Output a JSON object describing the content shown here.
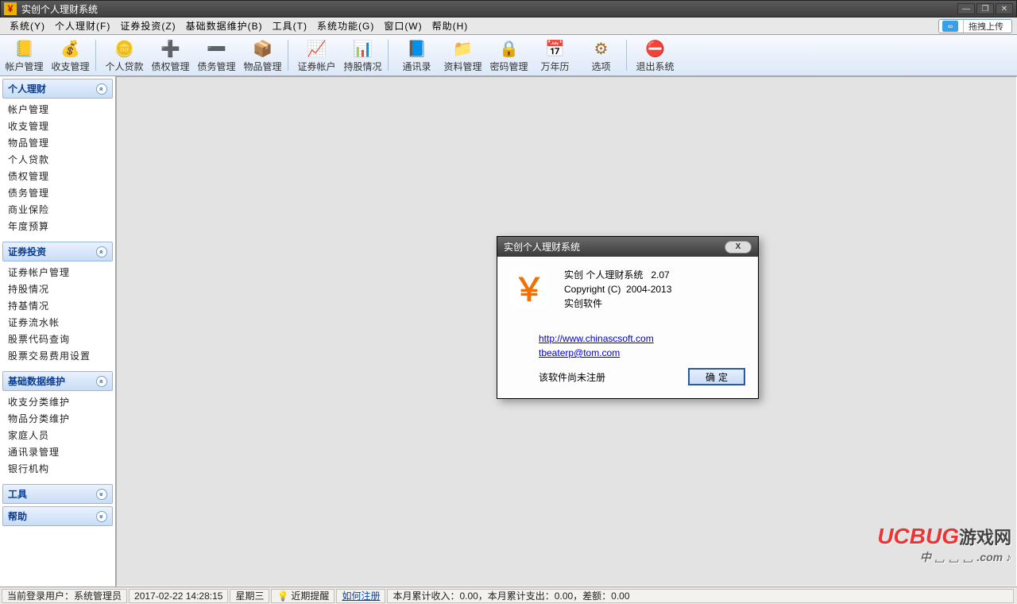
{
  "title": "实创个人理财系统",
  "menu": [
    "系统(Y)",
    "个人理财(F)",
    "证券投资(Z)",
    "基础数据维护(B)",
    "工具(T)",
    "系统功能(G)",
    "窗口(W)",
    "帮助(H)"
  ],
  "upload_label": "拖拽上传",
  "toolbar": [
    {
      "label": "帐户管理",
      "icon": "📒",
      "color": "#d39a00"
    },
    {
      "label": "收支管理",
      "icon": "💰",
      "color": "#d39a00"
    },
    {
      "label": "个人贷款",
      "icon": "🪙",
      "color": "#c08000"
    },
    {
      "label": "债权管理",
      "icon": "➕",
      "color": "#2a9a2a"
    },
    {
      "label": "债务管理",
      "icon": "➖",
      "color": "#c03020"
    },
    {
      "label": "物品管理",
      "icon": "📦",
      "color": "#a06a20"
    },
    {
      "label": "证券帐户",
      "icon": "📈",
      "color": "#2a7a2a"
    },
    {
      "label": "持股情况",
      "icon": "📊",
      "color": "#c05a20"
    },
    {
      "label": "通讯录",
      "icon": "📘",
      "color": "#2a5ac0"
    },
    {
      "label": "资料管理",
      "icon": "📁",
      "color": "#c07a20"
    },
    {
      "label": "密码管理",
      "icon": "🔒",
      "color": "#2a6ac0"
    },
    {
      "label": "万年历",
      "icon": "📅",
      "color": "#c03020"
    },
    {
      "label": "选项",
      "icon": "⚙",
      "color": "#a06a20"
    },
    {
      "label": "退出系统",
      "icon": "⛔",
      "color": "#c02020"
    }
  ],
  "toolbar_separators_after": [
    1,
    5,
    7,
    12
  ],
  "sidebar": [
    {
      "title": "个人理财",
      "items": [
        "帐户管理",
        "收支管理",
        "物品管理",
        "个人贷款",
        "债权管理",
        "债务管理",
        "商业保险",
        "年度预算"
      ]
    },
    {
      "title": "证券投资",
      "items": [
        "证券帐户管理",
        "持股情况",
        "持基情况",
        "证券流水帐",
        "股票代码查询",
        "股票交易费用设置"
      ]
    },
    {
      "title": "基础数据维护",
      "items": [
        "收支分类维护",
        "物品分类维护",
        "家庭人员",
        "通讯录管理",
        "银行机构"
      ]
    },
    {
      "title": "工具",
      "items": []
    },
    {
      "title": "帮助",
      "items": []
    }
  ],
  "about": {
    "title": "实创个人理财系统",
    "line1": "实创 个人理财系统   2.07",
    "line2": "Copyright (C)  2004-2013",
    "line3": "实创软件",
    "url": "http://www.chinascsoft.com",
    "email": "tbeaterp@tom.com",
    "reg_status": "该软件尚未注册",
    "ok": "确定"
  },
  "status": {
    "user_label": "当前登录用户：系统管理员",
    "datetime": "2017-02-22 14:28:15",
    "weekday": "星期三",
    "reminder": "近期提醒",
    "howto": "如何注册",
    "summary": "本月累计收入：0.00，本月累计支出：0.00，差额：0.00"
  },
  "watermark": {
    "brand": "UCBUG",
    "suffix": "游戏网",
    "sub": ".com"
  }
}
